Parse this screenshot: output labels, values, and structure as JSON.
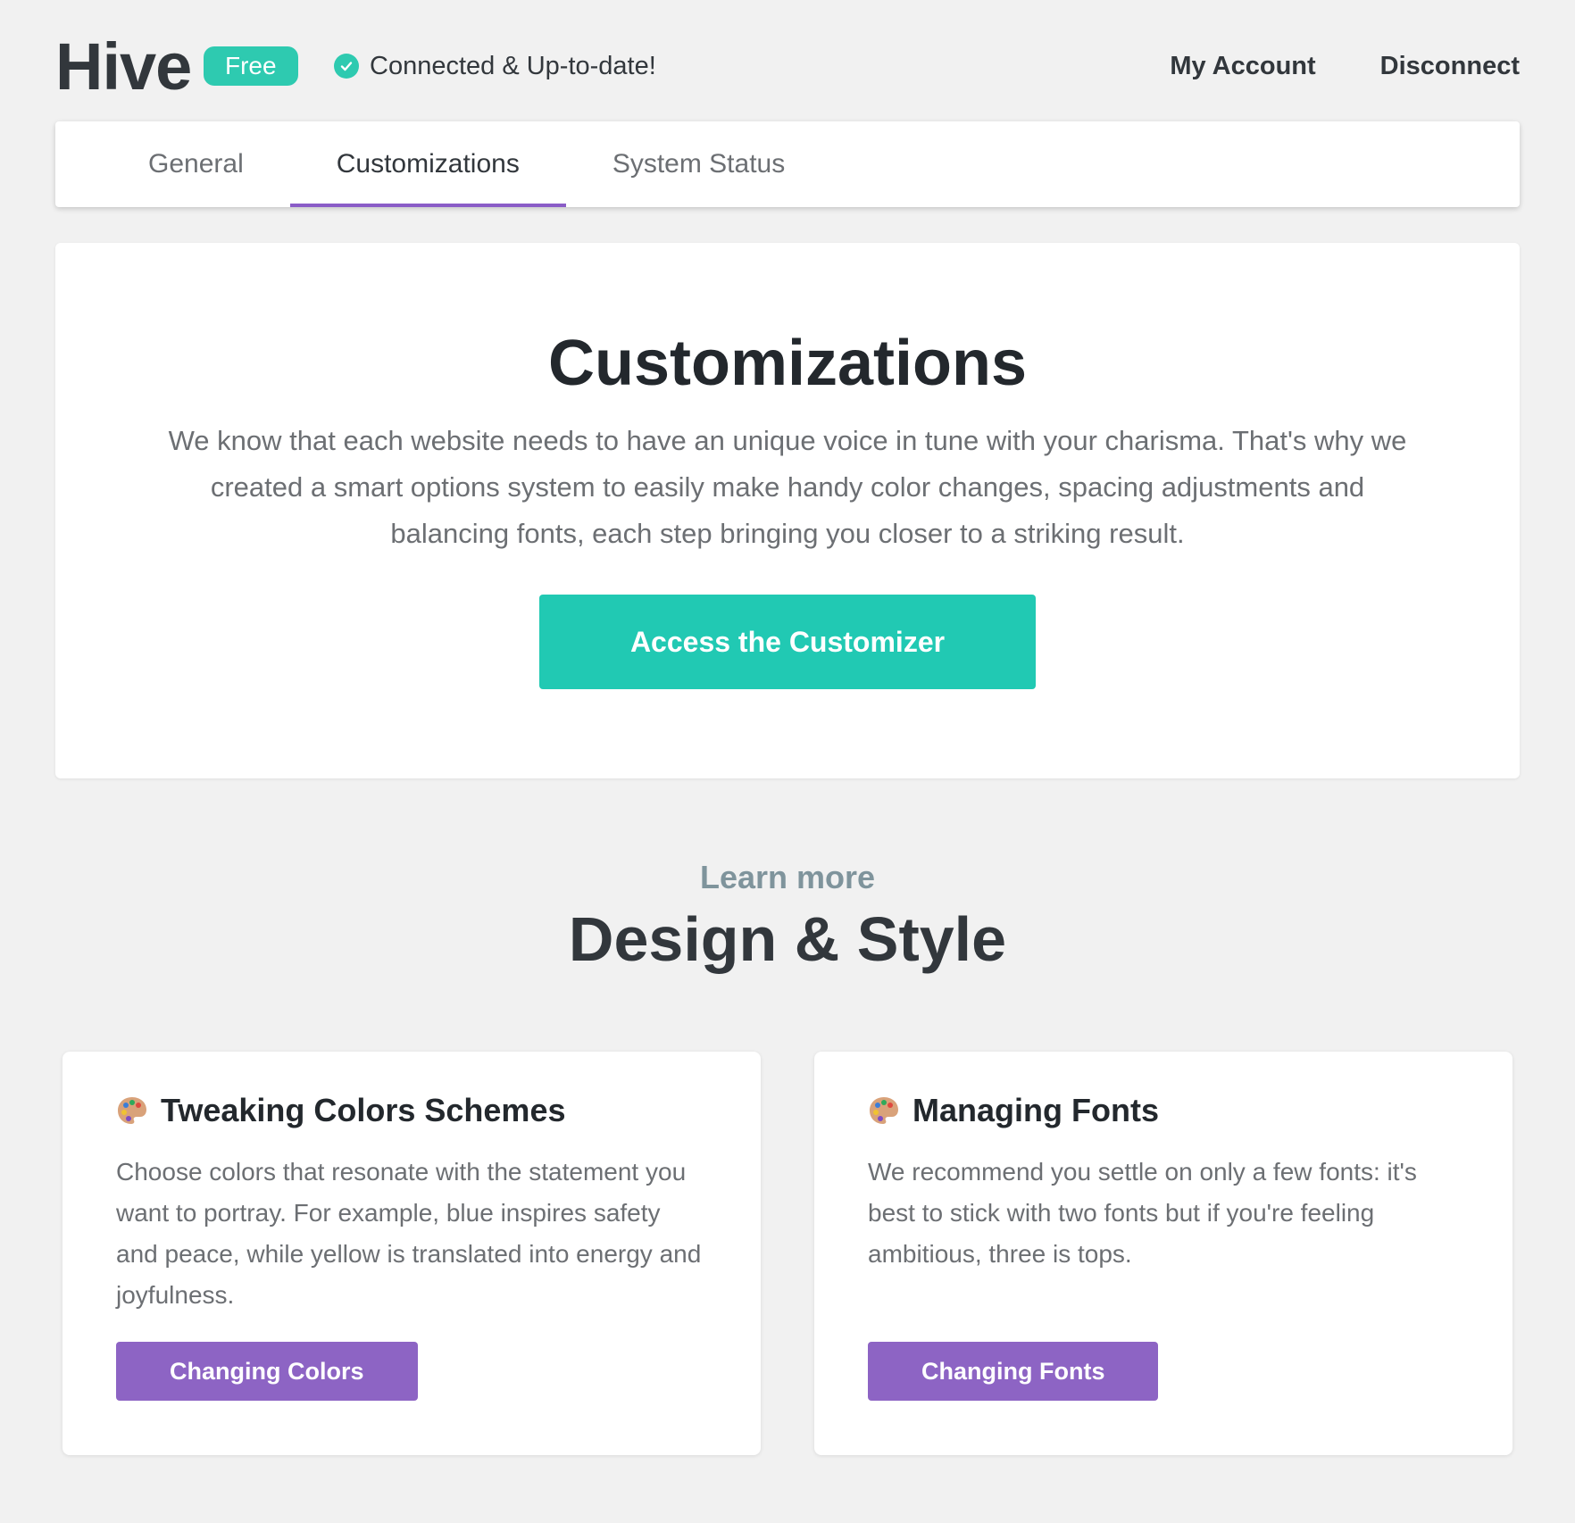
{
  "header": {
    "logo": "Hive",
    "badge": "Free",
    "status": "Connected & Up-to-date!",
    "links": [
      "My Account",
      "Disconnect"
    ]
  },
  "tabs": [
    {
      "label": "General",
      "active": false
    },
    {
      "label": "Customizations",
      "active": true
    },
    {
      "label": "System Status",
      "active": false
    }
  ],
  "hero": {
    "title": "Customizations",
    "description": "We know that each website needs to have an unique voice in tune with your charisma. That's why we created a smart options system to easily make handy color changes, spacing adjustments and balancing fonts, each step bringing you closer to a striking result.",
    "button": "Access the Customizer"
  },
  "section": {
    "subtitle": "Learn more",
    "title": "Design & Style"
  },
  "cards": [
    {
      "icon": "palette-icon",
      "title": "Tweaking Colors Schemes",
      "text": "Choose colors that resonate with the statement you want to portray. For example, blue inspires safety and peace, while yellow is translated into energy and joyfulness.",
      "button": "Changing Colors"
    },
    {
      "icon": "palette-icon",
      "title": "Managing Fonts",
      "text": "We recommend you settle on only a few fonts: it's best to stick with two fonts but if you're feeling ambitious, three is tops.",
      "button": "Changing Fonts"
    }
  ],
  "colors": {
    "accent_teal": "#21c9b3",
    "accent_purple": "#8d64c4",
    "background": "#f1f1f1"
  }
}
